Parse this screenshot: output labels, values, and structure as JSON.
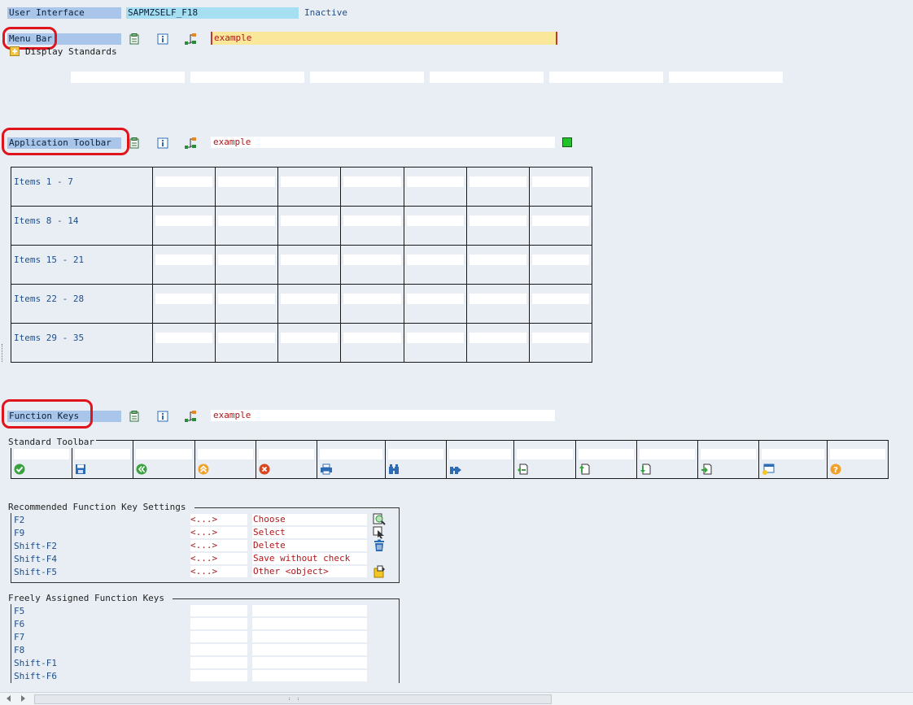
{
  "header": {
    "ui_label": "User Interface",
    "program": "SAPMZSELF_F18",
    "status": "Inactive"
  },
  "menu_bar": {
    "label": "Menu Bar",
    "example": "example",
    "display_standards": "Display Standards"
  },
  "app_toolbar": {
    "label": "Application Toolbar",
    "example": "example",
    "rows": [
      "Items  1 -  7",
      "Items  8 - 14",
      "Items 15 - 21",
      "Items 22 - 28",
      "Items 29 - 35"
    ]
  },
  "function_keys": {
    "label": "Function Keys",
    "example": "example",
    "standard_toolbar_title": "Standard Toolbar",
    "standard_icons": [
      "check-icon",
      "save-icon",
      "back-icon",
      "exit-icon",
      "cancel-icon",
      "print-icon",
      "find-icon",
      "find-next-icon",
      "first-page-icon",
      "previous-page-icon",
      "next-page-icon",
      "last-page-icon",
      "create-session-icon",
      "help-icon"
    ],
    "recommended_title": "Recommended Function Key Settings",
    "recommended": [
      {
        "key": "F2",
        "code": "<...>",
        "text": "Choose"
      },
      {
        "key": "F9",
        "code": "<...>",
        "text": "Select"
      },
      {
        "key": "Shift-F2",
        "code": "<...>",
        "text": "Delete"
      },
      {
        "key": "Shift-F4",
        "code": "<...>",
        "text": "Save without check"
      },
      {
        "key": "Shift-F5",
        "code": "<...>",
        "text": "Other <object>"
      }
    ],
    "free_title": "Freely Assigned Function Keys",
    "free": [
      "F5",
      "F6",
      "F7",
      "F8",
      "Shift-F1",
      "Shift-F6"
    ]
  },
  "colors": {
    "label_bg": "#a9c6ea",
    "highlight_field": "#fbe79a",
    "annotation_red": "#e0141d",
    "status_green": "#22c32a"
  }
}
